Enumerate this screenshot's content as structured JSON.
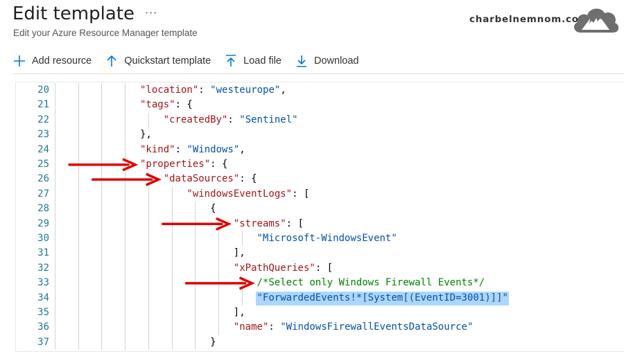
{
  "header": {
    "title": "Edit template",
    "more_icon": "ellipsis-icon",
    "subtitle": "Edit your Azure Resource Manager template",
    "brand": "charbelnemnom.com"
  },
  "toolbar": {
    "items": [
      {
        "label": "Add resource",
        "icon": "plus-icon"
      },
      {
        "label": "Quickstart template",
        "icon": "arrow-up-icon"
      },
      {
        "label": "Load file",
        "icon": "upload-icon"
      },
      {
        "label": "Download",
        "icon": "download-icon"
      }
    ]
  },
  "colors": {
    "key": "#a31515",
    "string": "#0451a5",
    "comment": "#008000",
    "line_number": "#237893",
    "selection": "#add6ff",
    "arrow": "#e00000",
    "toolbar_icon": "#0078d4"
  },
  "editor": {
    "lines": [
      {
        "n": "20",
        "indent": 5,
        "tokens": [
          {
            "t": "key",
            "v": "\"location\""
          },
          {
            "t": "pun",
            "v": ": "
          },
          {
            "t": "str",
            "v": "\"westeurope\""
          },
          {
            "t": "pun",
            "v": ","
          }
        ]
      },
      {
        "n": "21",
        "indent": 5,
        "tokens": [
          {
            "t": "key",
            "v": "\"tags\""
          },
          {
            "t": "pun",
            "v": ": {"
          }
        ]
      },
      {
        "n": "22",
        "indent": 6,
        "tokens": [
          {
            "t": "key",
            "v": "\"createdBy\""
          },
          {
            "t": "pun",
            "v": ": "
          },
          {
            "t": "str",
            "v": "\"Sentinel\""
          }
        ]
      },
      {
        "n": "23",
        "indent": 5,
        "tokens": [
          {
            "t": "pun",
            "v": "},"
          }
        ]
      },
      {
        "n": "24",
        "indent": 5,
        "tokens": [
          {
            "t": "key",
            "v": "\"kind\""
          },
          {
            "t": "pun",
            "v": ": "
          },
          {
            "t": "str",
            "v": "\"Windows\""
          },
          {
            "t": "pun",
            "v": ","
          }
        ]
      },
      {
        "n": "25",
        "indent": 5,
        "tokens": [
          {
            "t": "key",
            "v": "\"properties\""
          },
          {
            "t": "pun",
            "v": ": {"
          }
        ]
      },
      {
        "n": "26",
        "indent": 6,
        "tokens": [
          {
            "t": "key",
            "v": "\"dataSources\""
          },
          {
            "t": "pun",
            "v": ": {"
          }
        ]
      },
      {
        "n": "27",
        "indent": 7,
        "tokens": [
          {
            "t": "key",
            "v": "\"windowsEventLogs\""
          },
          {
            "t": "pun",
            "v": ": ["
          }
        ]
      },
      {
        "n": "28",
        "indent": 8,
        "tokens": [
          {
            "t": "pun",
            "v": "{"
          }
        ]
      },
      {
        "n": "29",
        "indent": 9,
        "tokens": [
          {
            "t": "key",
            "v": "\"streams\""
          },
          {
            "t": "pun",
            "v": ": ["
          }
        ]
      },
      {
        "n": "30",
        "indent": 10,
        "tokens": [
          {
            "t": "str",
            "v": "\"Microsoft-WindowsEvent\""
          }
        ]
      },
      {
        "n": "31",
        "indent": 9,
        "tokens": [
          {
            "t": "pun",
            "v": "],"
          }
        ]
      },
      {
        "n": "32",
        "indent": 9,
        "tokens": [
          {
            "t": "key",
            "v": "\"xPathQueries\""
          },
          {
            "t": "pun",
            "v": ": ["
          }
        ]
      },
      {
        "n": "33",
        "indent": 10,
        "tokens": [
          {
            "t": "cmt",
            "v": "/*Select only Windows Firewall Events*/"
          }
        ]
      },
      {
        "n": "34",
        "indent": 10,
        "tokens": [
          {
            "t": "str",
            "v": "\"ForwardedEvents!*[System[(EventID=3001)]]\""
          }
        ],
        "selected": true
      },
      {
        "n": "35",
        "indent": 9,
        "tokens": [
          {
            "t": "pun",
            "v": "],"
          }
        ]
      },
      {
        "n": "36",
        "indent": 9,
        "tokens": [
          {
            "t": "key",
            "v": "\"name\""
          },
          {
            "t": "pun",
            "v": ": "
          },
          {
            "t": "str",
            "v": "\"WindowsFirewallEventsDataSource\""
          }
        ]
      },
      {
        "n": "37",
        "indent": 8,
        "tokens": [
          {
            "t": "pun",
            "v": "}"
          }
        ]
      }
    ]
  },
  "annotations": [
    {
      "line": 6,
      "icon": "red-arrow-icon"
    },
    {
      "line": 7,
      "icon": "red-arrow-icon"
    },
    {
      "line": 10,
      "icon": "red-arrow-icon"
    },
    {
      "line": 14,
      "icon": "red-arrow-icon"
    }
  ]
}
